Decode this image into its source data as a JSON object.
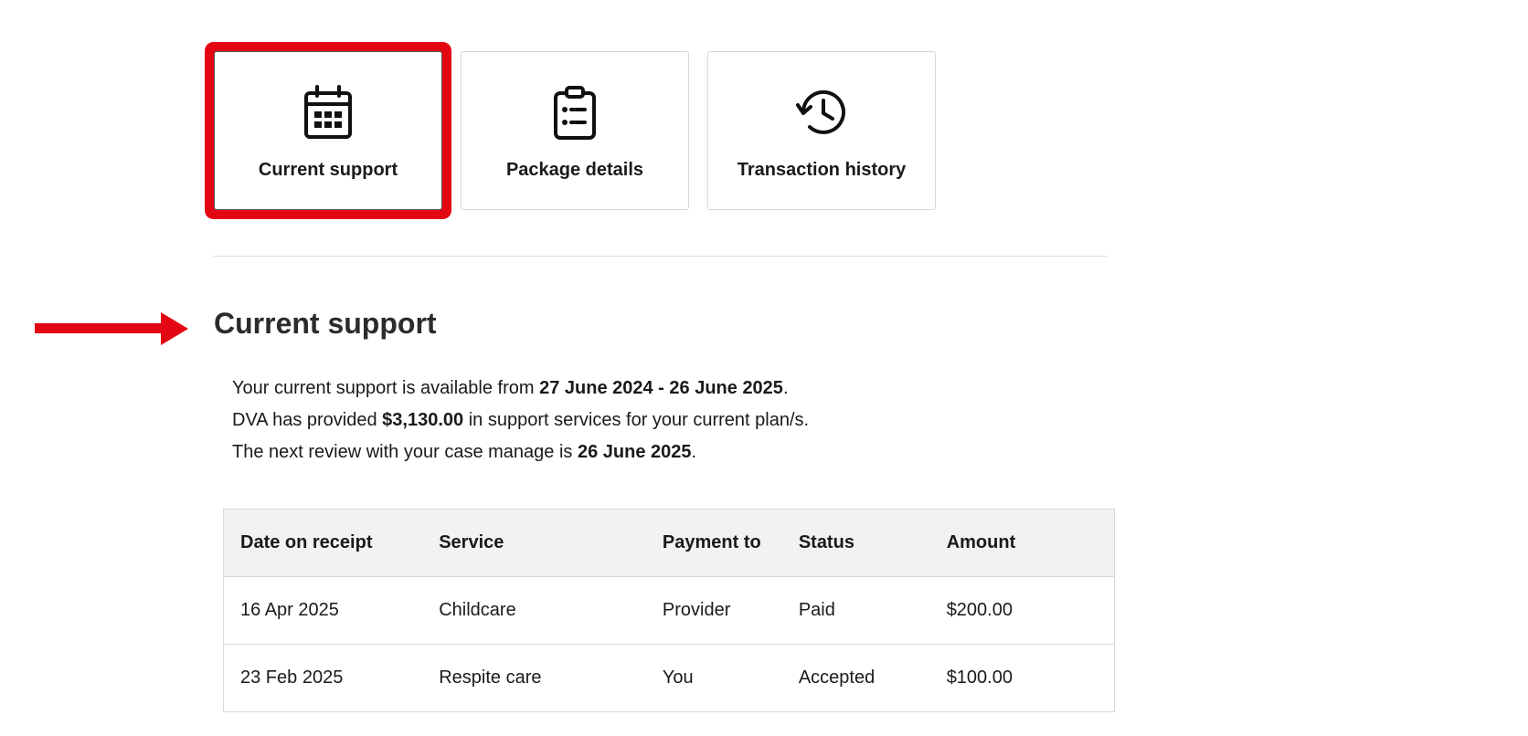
{
  "tabs": [
    {
      "label": "Current support",
      "icon": "calendar-icon",
      "selected": true
    },
    {
      "label": "Package details",
      "icon": "clipboard-list-icon",
      "selected": false
    },
    {
      "label": "Transaction history",
      "icon": "history-icon",
      "selected": false
    }
  ],
  "highlight_color": "#e30613",
  "section": {
    "title": "Current support",
    "line1_prefix": "Your current support is available from ",
    "line1_bold": "27 June 2024 - 26 June 2025",
    "line1_suffix": ".",
    "line2_prefix": "DVA has provided ",
    "line2_bold": "$3,130.00",
    "line2_suffix": " in support services for your current plan/s.",
    "line3_prefix": "The next review with your case manage is ",
    "line3_bold": "26 June 2025",
    "line3_suffix": "."
  },
  "table": {
    "headers": [
      "Date on receipt",
      "Service",
      "Payment to",
      "Status",
      "Amount"
    ],
    "rows": [
      [
        "16 Apr 2025",
        "Childcare",
        "Provider",
        "Paid",
        "$200.00"
      ],
      [
        "23 Feb 2025",
        "Respite care",
        "You",
        "Accepted",
        "$100.00"
      ]
    ]
  }
}
